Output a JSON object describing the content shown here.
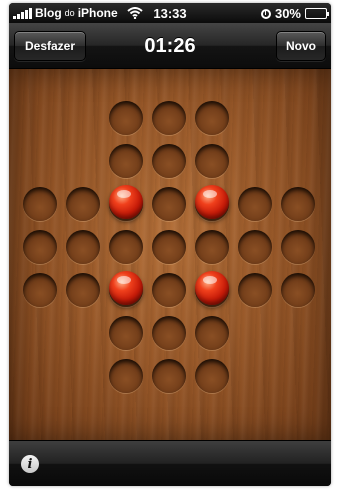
{
  "status_bar": {
    "carrier": "Blog",
    "carrier_small": "do",
    "carrier_suffix": "iPhone",
    "time": "13:33",
    "battery": "30%",
    "battery_level": 0.3,
    "icons": [
      "signal-icon",
      "wifi-icon",
      "alarm-icon",
      "battery-icon"
    ]
  },
  "nav": {
    "undo_label": "Desfazer",
    "timer": "01:26",
    "new_label": "Novo"
  },
  "board": {
    "layout": [
      "..ooo..",
      "..ooo..",
      "ooPoPoo",
      "ooooooo",
      "ooPoPoo",
      "..ooo..",
      "..ooo.."
    ],
    "legend": {
      ".": "empty-space",
      "o": "hole",
      "P": "peg"
    },
    "peg_color": "#d52a10",
    "wood_color": "#9a5a2a"
  },
  "bottom": {
    "info_icon": "i"
  }
}
